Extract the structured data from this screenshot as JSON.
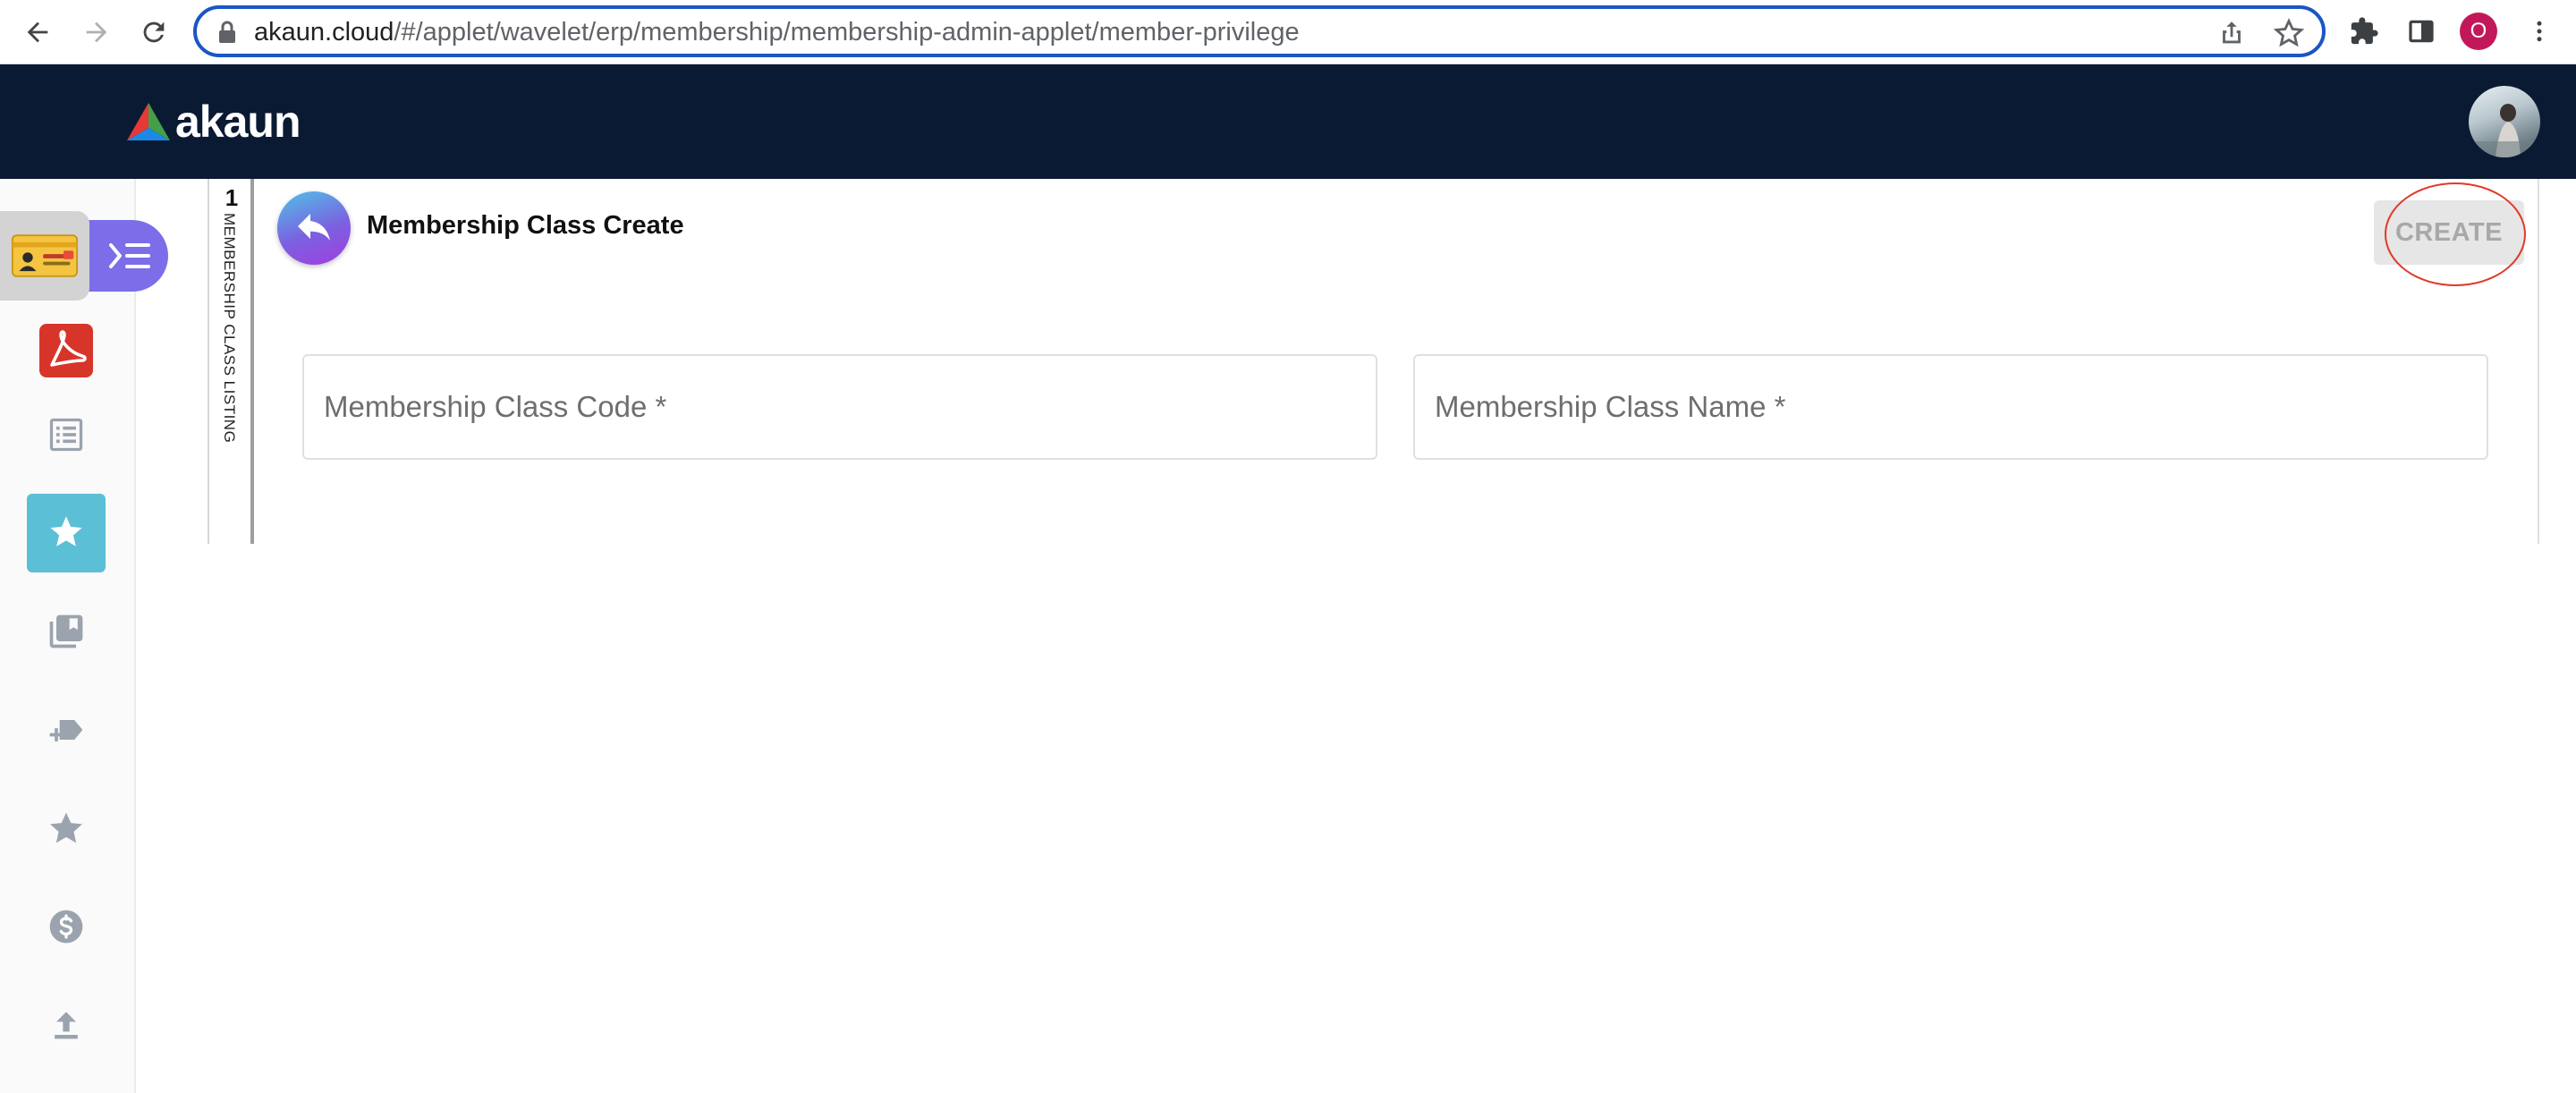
{
  "browser": {
    "url_host": "akaun.cloud",
    "url_path": "/#/applet/wavelet/erp/membership/membership-admin-applet/member-privilege",
    "profile_initial": "O"
  },
  "header": {
    "logo_text": "akaun"
  },
  "sidebar": {
    "items": [
      {
        "icon": "membership-card-icon"
      },
      {
        "icon": "acrobat-icon"
      },
      {
        "icon": "list-icon"
      },
      {
        "icon": "star-sparkle-icon",
        "active": true
      },
      {
        "icon": "library-books-icon"
      },
      {
        "icon": "tag-add-icon"
      },
      {
        "icon": "star-icon"
      },
      {
        "icon": "dollar-icon"
      },
      {
        "icon": "upload-icon"
      }
    ]
  },
  "listing": {
    "count": "1",
    "label": "MEMBERSHIP CLASS LISTING"
  },
  "page": {
    "title": "Membership Class Create",
    "create_label": "CREATE"
  },
  "form": {
    "code_placeholder": "Membership Class Code *",
    "code_value": "",
    "name_placeholder": "Membership Class Name *",
    "name_value": ""
  },
  "colors": {
    "header_bg": "#0b1a33",
    "applet_accent": "#7b6ee8",
    "active_item": "#5bbfd6",
    "annotation_ring": "#e03a2b"
  }
}
